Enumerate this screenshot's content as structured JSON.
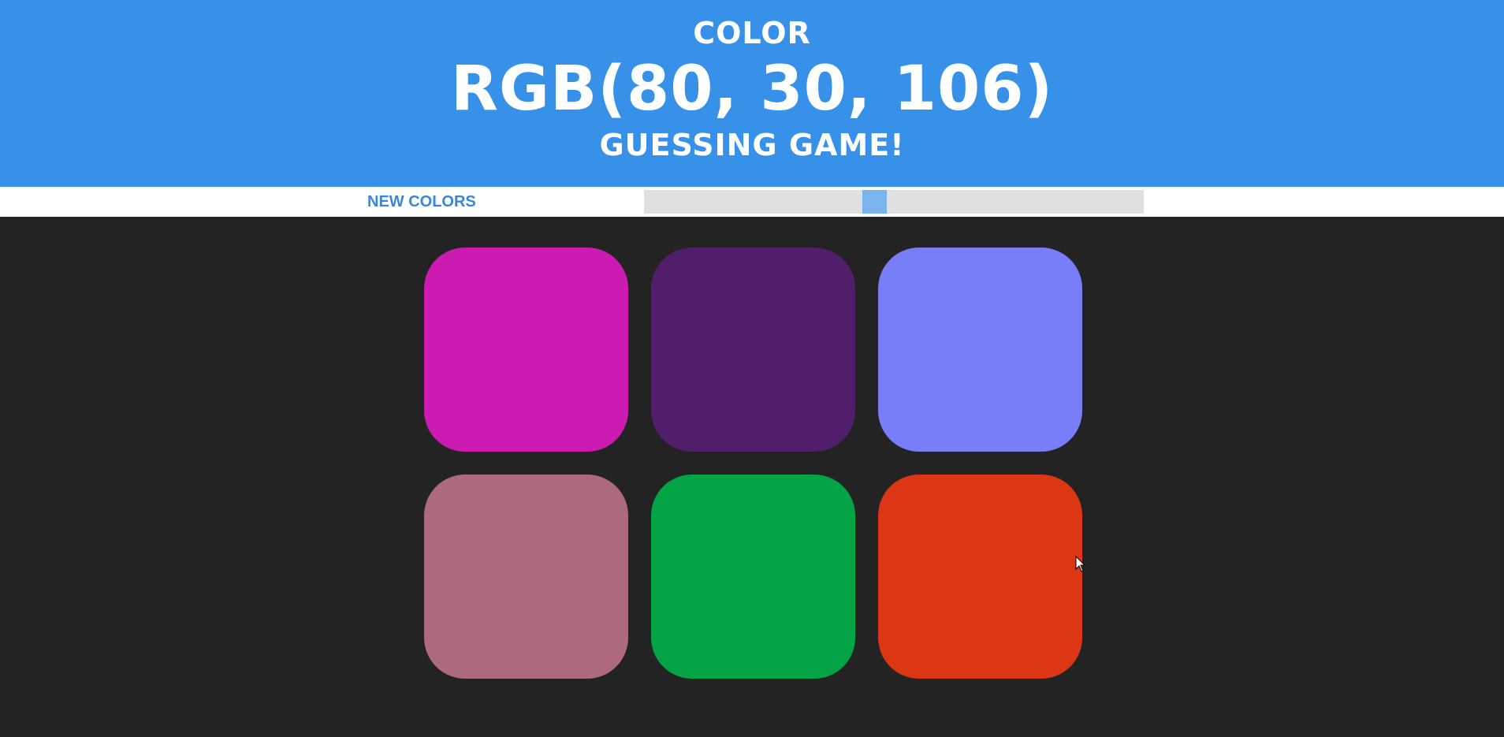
{
  "header": {
    "line1": "COLOR",
    "rgb_display": "RGB(80, 30, 106)",
    "line3": "GUESSING GAME!",
    "background_color": "#3791e8"
  },
  "controls": {
    "new_colors_label": "NEW COLORS",
    "slider_value_fraction": 0.46
  },
  "board": {
    "background_color": "#232323",
    "squares": [
      {
        "color": "#cb1bb3"
      },
      {
        "color": "#501e6a"
      },
      {
        "color": "#777ef8"
      },
      {
        "color": "#ac6a7b"
      },
      {
        "color": "#03a445"
      },
      {
        "color": "#dc3615"
      }
    ]
  },
  "icons": {
    "cursor": "mouse-pointer-icon"
  }
}
